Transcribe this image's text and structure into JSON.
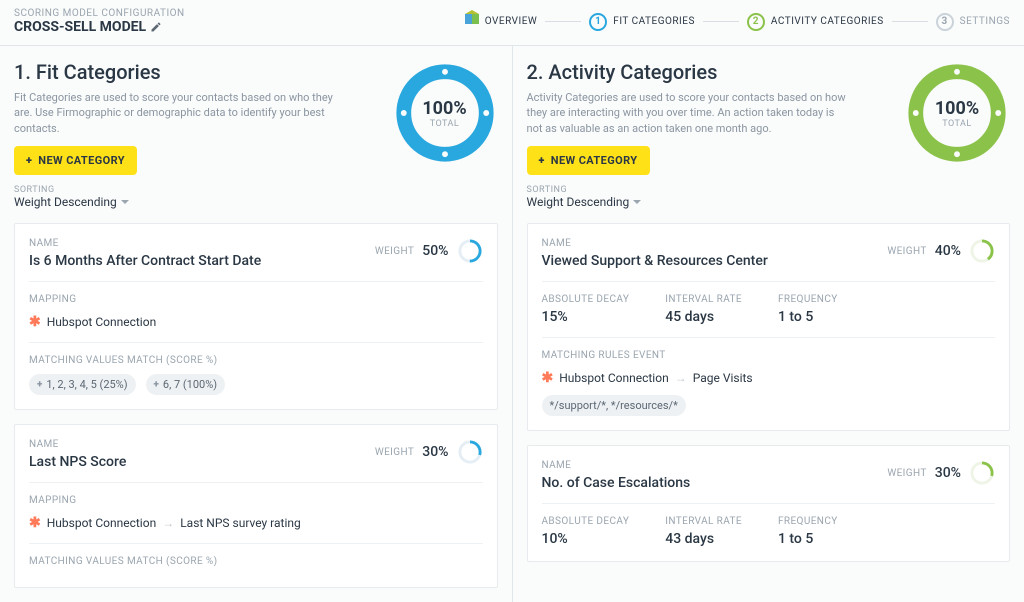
{
  "header": {
    "eyebrow": "SCORING MODEL CONFIGURATION",
    "model_name": "CROSS-SELL MODEL"
  },
  "stepper": {
    "overview": "OVERVIEW",
    "fit": {
      "num": "1",
      "label": "FIT CATEGORIES"
    },
    "activity": {
      "num": "2",
      "label": "ACTIVITY CATEGORIES"
    },
    "settings": {
      "num": "3",
      "label": "SETTINGS"
    }
  },
  "fit": {
    "title": "1. Fit Categories",
    "desc": "Fit Categories are used to score your contacts based on who they are. Use Firmographic or demographic data to identify your best contacts.",
    "new_btn": "NEW CATEGORY",
    "donut": {
      "pct": "100%",
      "total": "TOTAL",
      "color": "#29a8df"
    },
    "sorting_label": "SORTING",
    "sorting_value": "Weight Descending",
    "cards": [
      {
        "name_label": "NAME",
        "name": "Is 6 Months After Contract Start Date",
        "weight_label": "WEIGHT",
        "weight": "50%",
        "ring_pct": 50,
        "mapping_label": "MAPPING",
        "connection": "Hubspot Connection",
        "matches_label": "MATCHING VALUES MATCH (SCORE %)",
        "chips": [
          "1, 2, 3, 4, 5 (25%)",
          "6, 7 (100%)"
        ]
      },
      {
        "name_label": "NAME",
        "name": "Last NPS Score",
        "weight_label": "WEIGHT",
        "weight": "30%",
        "ring_pct": 30,
        "mapping_label": "MAPPING",
        "connection": "Hubspot Connection",
        "mapping_target": "Last NPS survey rating",
        "matches_label": "MATCHING VALUES MATCH (SCORE %)"
      }
    ]
  },
  "activity": {
    "title": "2. Activity Categories",
    "desc": "Activity Categories are used to score your contacts based on how they are interacting with you over time. An action taken today is not as valuable as an action taken one month ago.",
    "new_btn": "NEW CATEGORY",
    "donut": {
      "pct": "100%",
      "total": "TOTAL",
      "color": "#8bc34a"
    },
    "sorting_label": "SORTING",
    "sorting_value": "Weight Descending",
    "cards": [
      {
        "name_label": "NAME",
        "name": "Viewed Support & Resources Center",
        "weight_label": "WEIGHT",
        "weight": "40%",
        "ring_pct": 40,
        "metrics": {
          "decay_label": "ABSOLUTE DECAY",
          "decay": "15%",
          "interval_label": "INTERVAL RATE",
          "interval": "45 days",
          "freq_label": "FREQUENCY",
          "freq": "1 to 5"
        },
        "rules_label": "MATCHING RULES EVENT",
        "connection": "Hubspot Connection",
        "rules_target": "Page Visits",
        "rules_chip": "*/support/*, */resources/*"
      },
      {
        "name_label": "NAME",
        "name": "No. of Case Escalations",
        "weight_label": "WEIGHT",
        "weight": "30%",
        "ring_pct": 30,
        "metrics": {
          "decay_label": "ABSOLUTE DECAY",
          "decay": "10%",
          "interval_label": "INTERVAL RATE",
          "interval": "43 days",
          "freq_label": "FREQUENCY",
          "freq": "1 to 5"
        }
      }
    ]
  },
  "chart_data": [
    {
      "type": "pie",
      "title": "Fit Categories Total",
      "categories": [
        "Fit"
      ],
      "values": [
        100
      ]
    },
    {
      "type": "pie",
      "title": "Activity Categories Total",
      "categories": [
        "Activity"
      ],
      "values": [
        100
      ]
    }
  ]
}
